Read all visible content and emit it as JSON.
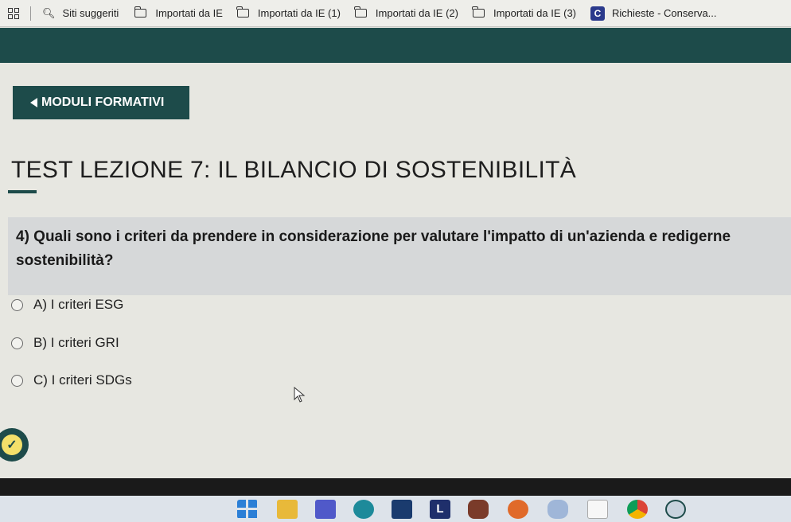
{
  "bookmarks": {
    "items": [
      {
        "label": "Siti suggeriti",
        "icon": "search-icon"
      },
      {
        "label": "Importati da IE",
        "icon": "folder-icon"
      },
      {
        "label": "Importati da IE (1)",
        "icon": "folder-icon"
      },
      {
        "label": "Importati da IE (2)",
        "icon": "folder-icon"
      },
      {
        "label": "Importati da IE (3)",
        "icon": "folder-icon"
      },
      {
        "label": "Richieste - Conserva...",
        "icon": "richieste-icon"
      }
    ]
  },
  "nav": {
    "back_label": "MODULI FORMATIVI"
  },
  "page": {
    "title": "TEST LEZIONE 7: IL BILANCIO DI SOSTENIBILITÀ"
  },
  "question": {
    "text": "4) Quali sono i criteri da prendere in considerazione per valutare l'impatto di un'azienda e redigerne sostenibilità?",
    "options": [
      {
        "label": "A) I criteri ESG"
      },
      {
        "label": "B) I criteri GRI"
      },
      {
        "label": "C) I criteri SDGs"
      }
    ]
  },
  "colors": {
    "brand": "#1d4b4a",
    "question_bg": "#d6d8d9",
    "page_bg": "#e7e7e1"
  },
  "taskbar": {
    "icons": [
      "start-icon",
      "file-explorer-icon",
      "teams-icon",
      "edge-icon",
      "store-icon",
      "app-l-icon",
      "app-icon",
      "firefox-icon",
      "paint-icon",
      "notepad-icon",
      "chrome-icon",
      "search-app-icon"
    ]
  }
}
